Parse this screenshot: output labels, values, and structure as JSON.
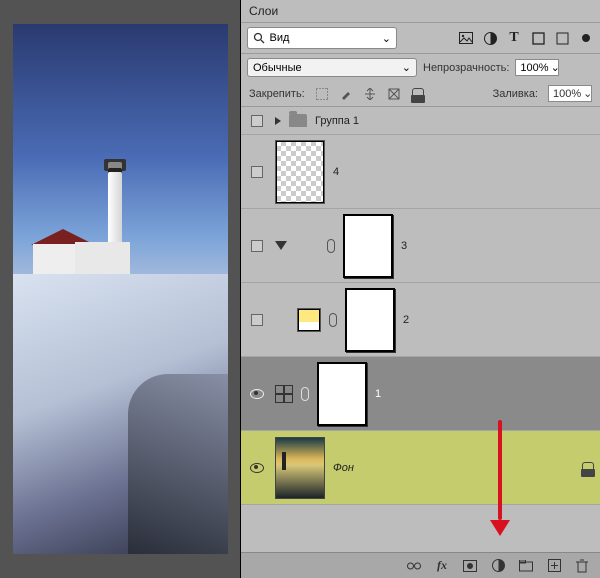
{
  "panel": {
    "title": "Слои"
  },
  "search": {
    "placeholder": "Вид"
  },
  "blend": {
    "mode": "Обычные",
    "opacity_label": "Непрозрачность:",
    "opacity_value": "100%",
    "fill_label": "Заливка:",
    "fill_value": "100%"
  },
  "lock": {
    "label": "Закрепить:"
  },
  "layers": {
    "group": {
      "name": "Группа 1"
    },
    "l4": {
      "name": "4"
    },
    "l3": {
      "name": "3"
    },
    "l2": {
      "name": "2"
    },
    "l1": {
      "name": "1"
    },
    "bg": {
      "name": "Фон"
    }
  },
  "icons": {
    "search": "search-icon",
    "image": "image-icon",
    "adjust": "adjustment-icon",
    "text": "text-icon",
    "shape": "shape-icon",
    "smart": "smart-object-icon",
    "dot": "dot-icon",
    "locktrans": "lock-transparency-icon",
    "lockbrush": "lock-brush-icon",
    "lockmove": "lock-move-icon",
    "lockframe": "lock-frame-icon",
    "lockall": "lock-all-icon",
    "link": "link-icon",
    "fx": "fx-icon",
    "mask": "mask-icon",
    "fill": "fill-adjust-icon",
    "folder": "folder-icon",
    "new": "new-layer-icon",
    "trash": "trash-icon"
  }
}
